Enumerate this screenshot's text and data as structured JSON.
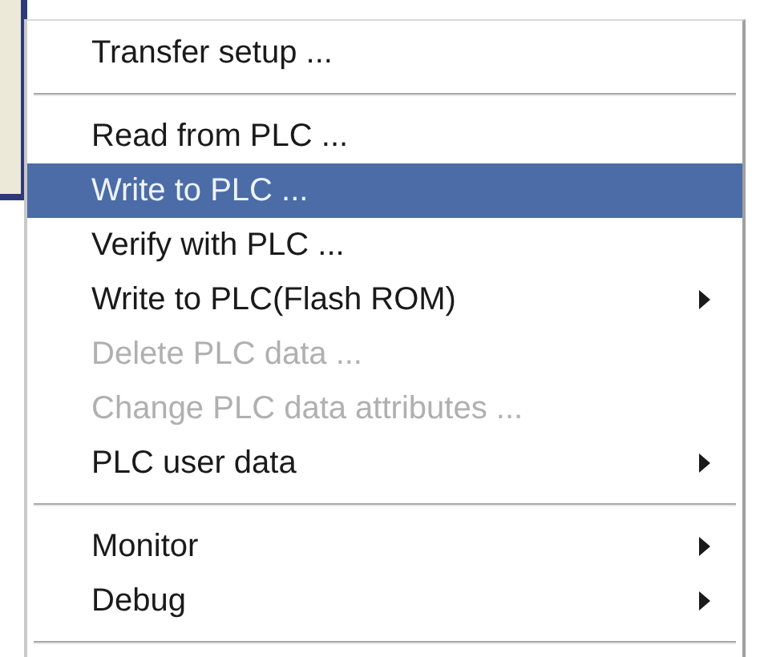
{
  "menu": {
    "items": [
      {
        "kind": "item",
        "label": "Transfer setup ...",
        "selected": false,
        "disabled": false,
        "submenu": false
      },
      {
        "kind": "separator"
      },
      {
        "kind": "item",
        "label": "Read from PLC ...",
        "selected": false,
        "disabled": false,
        "submenu": false
      },
      {
        "kind": "item",
        "label": "Write to PLC ...",
        "selected": true,
        "disabled": false,
        "submenu": false
      },
      {
        "kind": "item",
        "label": "Verify with PLC ...",
        "selected": false,
        "disabled": false,
        "submenu": false
      },
      {
        "kind": "item",
        "label": "Write to PLC(Flash ROM)",
        "selected": false,
        "disabled": false,
        "submenu": true
      },
      {
        "kind": "item",
        "label": "Delete PLC data ...",
        "selected": false,
        "disabled": true,
        "submenu": false
      },
      {
        "kind": "item",
        "label": "Change PLC data attributes ...",
        "selected": false,
        "disabled": true,
        "submenu": false
      },
      {
        "kind": "item",
        "label": "PLC user data",
        "selected": false,
        "disabled": false,
        "submenu": true
      },
      {
        "kind": "separator"
      },
      {
        "kind": "item",
        "label": "Monitor",
        "selected": false,
        "disabled": false,
        "submenu": true
      },
      {
        "kind": "item",
        "label": "Debug",
        "selected": false,
        "disabled": false,
        "submenu": true
      },
      {
        "kind": "separator"
      }
    ]
  }
}
